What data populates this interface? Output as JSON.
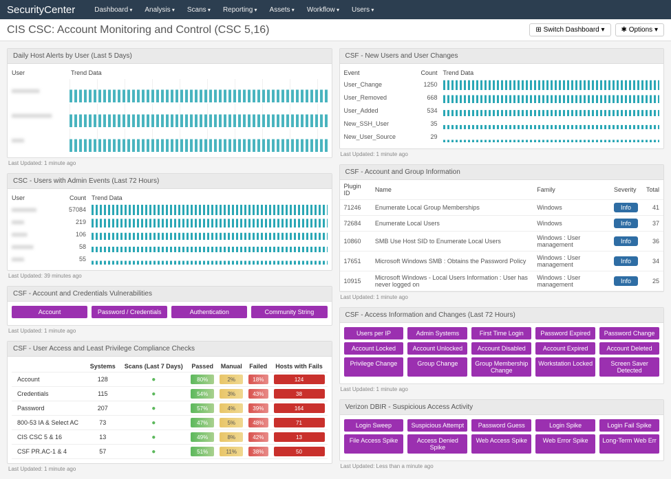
{
  "nav": {
    "brand": "SecurityCenter",
    "items": [
      "Dashboard",
      "Analysis",
      "Scans",
      "Reporting",
      "Assets",
      "Workflow",
      "Users"
    ]
  },
  "page": {
    "title": "CIS CSC: Account Monitoring and Control (CSC 5,16)",
    "switch": "Switch Dashboard",
    "options": "Options"
  },
  "cards": {
    "dailyHost": {
      "title": "Daily Host Alerts by User (Last 5 Days)",
      "updated": "Last Updated: 1 minute ago",
      "cols": {
        "user": "User",
        "trend": "Trend Data"
      },
      "rows": [
        {
          "user": "xxxxxxxxx"
        },
        {
          "user": "xxxxxxxxxxxxx"
        },
        {
          "user": "xxxx"
        }
      ]
    },
    "newUsers": {
      "title": "CSF - New Users and User Changes",
      "updated": "Last Updated: 1 minute ago",
      "cols": {
        "event": "Event",
        "count": "Count",
        "trend": "Trend Data"
      },
      "rows": [
        {
          "event": "User_Change",
          "count": "1250"
        },
        {
          "event": "User_Removed",
          "count": "668"
        },
        {
          "event": "User_Added",
          "count": "534"
        },
        {
          "event": "New_SSH_User",
          "count": "35"
        },
        {
          "event": "New_User_Source",
          "count": "29"
        }
      ]
    },
    "adminEvents": {
      "title": "CSC - Users with Admin Events (Last 72 Hours)",
      "updated": "Last Updated: 39 minutes ago",
      "cols": {
        "user": "User",
        "count": "Count",
        "trend": "Trend Data"
      },
      "rows": [
        {
          "user": "xxxxxxxx",
          "count": "57084"
        },
        {
          "user": "xxxx",
          "count": "219"
        },
        {
          "user": "xxxxx",
          "count": "106"
        },
        {
          "user": "xxxxxxx",
          "count": "58"
        },
        {
          "user": "xxxx",
          "count": "55"
        }
      ]
    },
    "acctGroup": {
      "title": "CSF - Account and Group Information",
      "updated": "Last Updated: 1 minute ago",
      "cols": {
        "plugin": "Plugin ID",
        "name": "Name",
        "family": "Family",
        "severity": "Severity",
        "total": "Total"
      },
      "rows": [
        {
          "plugin": "71246",
          "name": "Enumerate Local Group Memberships",
          "family": "Windows",
          "sev": "Info",
          "total": "41"
        },
        {
          "plugin": "72684",
          "name": "Enumerate Local Users",
          "family": "Windows",
          "sev": "Info",
          "total": "37"
        },
        {
          "plugin": "10860",
          "name": "SMB Use Host SID to Enumerate Local Users",
          "family": "Windows : User management",
          "sev": "Info",
          "total": "36"
        },
        {
          "plugin": "17651",
          "name": "Microsoft Windows SMB : Obtains the Password Policy",
          "family": "Windows : User management",
          "sev": "Info",
          "total": "34"
        },
        {
          "plugin": "10915",
          "name": "Microsoft Windows - Local Users Information : User has never logged on",
          "family": "Windows : User management",
          "sev": "Info",
          "total": "25"
        }
      ]
    },
    "credVuln": {
      "title": "CSF - Account and Credentials Vulnerabilities",
      "updated": "Last Updated: 1 minute ago",
      "pills": [
        "Account",
        "Password / Credentials",
        "Authentication",
        "Community String"
      ]
    },
    "accessInfo": {
      "title": "CSF - Access Information and Changes (Last 72 Hours)",
      "updated": "Last Updated: 1 minute ago",
      "rows": [
        [
          "Users per IP",
          "Admin Systems",
          "First Time Login",
          "Password Expired",
          "Password Change"
        ],
        [
          "Account Locked",
          "Account Unlocked",
          "Account Disabled",
          "Account Expired",
          "Account Deleted"
        ],
        [
          "Privilege Change",
          "Group Change",
          "Group Membership Change",
          "Workstation Locked",
          "Screen Saver Detected"
        ]
      ]
    },
    "compliance": {
      "title": "CSF - User Access and Least Privilege Compliance Checks",
      "updated": "Last Updated: 1 minute ago",
      "cols": [
        "",
        "Systems",
        "Scans (Last 7 Days)",
        "Passed",
        "Manual",
        "Failed",
        "Hosts with Fails"
      ],
      "rows": [
        {
          "n": "Account",
          "sys": "128",
          "p": "80%",
          "m": "2%",
          "f": "18%",
          "h": "124"
        },
        {
          "n": "Credentials",
          "sys": "115",
          "p": "54%",
          "m": "3%",
          "f": "43%",
          "h": "38"
        },
        {
          "n": "Password",
          "sys": "207",
          "p": "57%",
          "m": "4%",
          "f": "39%",
          "h": "164"
        },
        {
          "n": "800-53 IA & Select AC",
          "sys": "73",
          "p": "47%",
          "m": "5%",
          "f": "48%",
          "h": "71"
        },
        {
          "n": "CIS CSC 5 & 16",
          "sys": "13",
          "p": "49%",
          "m": "8%",
          "f": "42%",
          "h": "13"
        },
        {
          "n": "CSF PR.AC-1 & 4",
          "sys": "57",
          "p": "51%",
          "m": "11%",
          "f": "38%",
          "h": "50"
        }
      ]
    },
    "dbir": {
      "title": "Verizon DBIR - Suspicious Access Activity",
      "updated": "Last Updated: Less than a minute ago",
      "rows": [
        [
          "Login Sweep",
          "Suspicious Attempt",
          "Password Guess",
          "Login Spike",
          "Login Fail Spike"
        ],
        [
          "File Access Spike",
          "Access Denied Spike",
          "Web Access Spike",
          "Web Error Spike",
          "Long-Term Web Err"
        ]
      ]
    }
  }
}
